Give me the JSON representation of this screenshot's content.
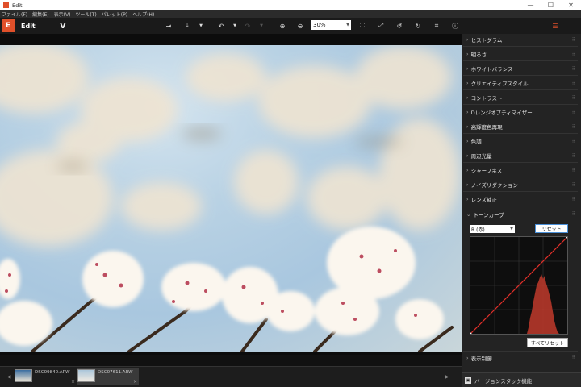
{
  "window": {
    "title": "Edit",
    "min": "—",
    "max": "☐",
    "close": "✕"
  },
  "menu": [
    "ファイル(F)",
    "編集(E)",
    "表示(V)",
    "ツール(T)",
    "パレット(P)",
    "ヘルプ(H)"
  ],
  "toolbar": {
    "edit_label": "Edit",
    "v_logo": "V",
    "zoom": "30%"
  },
  "filmstrip": {
    "items": [
      {
        "name": "DSC09840.ARW",
        "close": "×"
      },
      {
        "name": "DSC07611.ARW",
        "close": "×"
      }
    ]
  },
  "panel": {
    "sections": [
      "ヒストグラム",
      "明るさ",
      "ホワイトバランス",
      "クリエイティブスタイル",
      "コントラスト",
      "Dレンジオプティマイザー",
      "高輝度色再現",
      "色調",
      "周辺光量",
      "シャープネス",
      "ノイズリダクション",
      "レンズ補正",
      "トーンカーブ"
    ],
    "tone_channel": "R (赤)",
    "reset_label": "リセット",
    "reset_all_label": "すべてリセット",
    "bottom_section": "表示制御",
    "version_label": "バージョンスタック機能"
  },
  "colors": {
    "accent": "#e0502a",
    "curve": "#e0302a",
    "histogram": "#c0392b"
  }
}
